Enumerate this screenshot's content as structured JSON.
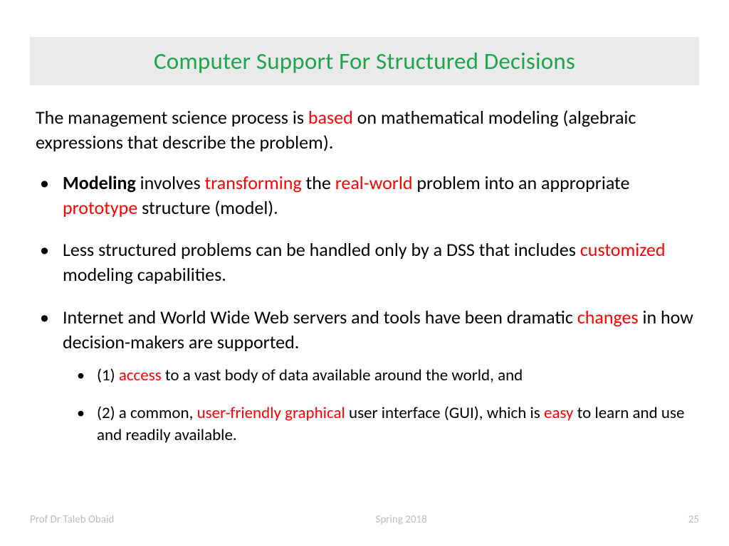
{
  "title": "Computer Support For Structured Decisions",
  "intro": {
    "pre": "The management science process is ",
    "red1": "based",
    "post": " on mathematical modeling (algebraic expressions that describe the problem)."
  },
  "bullets": [
    {
      "parts": [
        {
          "t": "Modeling",
          "cls": "bold"
        },
        {
          "t": " involves "
        },
        {
          "t": "transforming",
          "cls": "red"
        },
        {
          "t": " the "
        },
        {
          "t": "real-world",
          "cls": "red"
        },
        {
          "t": " problem into an appropriate "
        },
        {
          "t": "prototype",
          "cls": "red"
        },
        {
          "t": " structure (model)."
        }
      ]
    },
    {
      "parts": [
        {
          "t": "Less structured problems can be handled only by a DSS that includes "
        },
        {
          "t": "customized",
          "cls": "red"
        },
        {
          "t": " modeling capabilities."
        }
      ]
    },
    {
      "parts": [
        {
          "t": "Internet and World Wide Web servers and tools  have been dramatic "
        },
        {
          "t": "changes",
          "cls": "red"
        },
        {
          "t": " in how decision-makers are supported."
        }
      ],
      "sub": [
        {
          "parts": [
            {
              "t": "(1) "
            },
            {
              "t": "access",
              "cls": "red"
            },
            {
              "t": " to a vast body of data available around the world, and"
            }
          ]
        },
        {
          "parts": [
            {
              "t": "(2) a common, "
            },
            {
              "t": "user-friendly graphical",
              "cls": "red"
            },
            {
              "t": " user interface (GUI), which is "
            },
            {
              "t": "easy",
              "cls": "red"
            },
            {
              "t": " to learn and use and readily available."
            }
          ]
        }
      ]
    }
  ],
  "footer": {
    "left": "Prof Dr Taleb Obaid",
    "center": "Spring 2018",
    "right": "25"
  }
}
